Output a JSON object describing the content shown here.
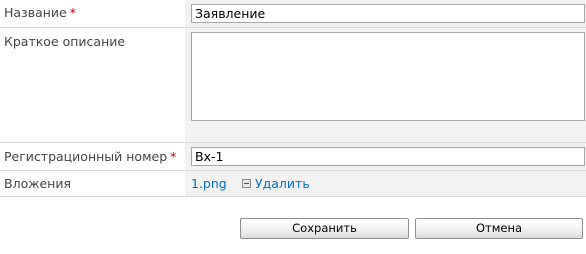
{
  "form": {
    "name": {
      "label": "Название",
      "required_mark": "*",
      "value": "Заявление"
    },
    "description": {
      "label": "Краткое описание",
      "value": ""
    },
    "registration_number": {
      "label": "Регистрационный номер",
      "required_mark": "*",
      "value": "Вх-1"
    },
    "attachments": {
      "label": "Вложения",
      "file_name": "1.png",
      "delete_label": "Удалить"
    }
  },
  "actions": {
    "save_label": "Сохранить",
    "cancel_label": "Отмена"
  },
  "colors": {
    "link": "#0072bc",
    "required": "#bf0000",
    "value_cell_bg": "#f1f1f1"
  }
}
